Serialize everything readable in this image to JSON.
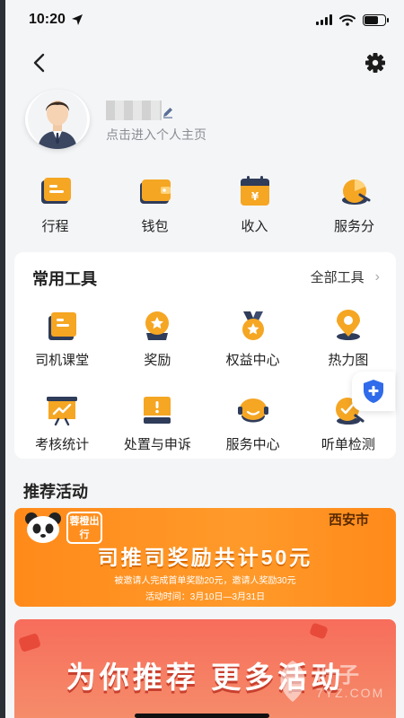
{
  "status_bar": {
    "time": "10:20",
    "battery_level": 0.7
  },
  "profile": {
    "subtitle": "点击进入个人主页"
  },
  "quick_actions": [
    {
      "label": "行程",
      "icon": "itinerary-icon"
    },
    {
      "label": "钱包",
      "icon": "wallet-icon"
    },
    {
      "label": "收入",
      "icon": "income-icon"
    },
    {
      "label": "服务分",
      "icon": "service-score-icon"
    }
  ],
  "tools": {
    "title": "常用工具",
    "all_label": "全部工具",
    "items": [
      {
        "label": "司机课堂",
        "icon": "driver-class-icon"
      },
      {
        "label": "奖励",
        "icon": "reward-icon"
      },
      {
        "label": "权益中心",
        "icon": "benefits-icon"
      },
      {
        "label": "热力图",
        "icon": "heatmap-icon"
      },
      {
        "label": "考核统计",
        "icon": "assessment-icon"
      },
      {
        "label": "处置与申诉",
        "icon": "appeal-icon"
      },
      {
        "label": "服务中心",
        "icon": "service-center-icon"
      },
      {
        "label": "听单检测",
        "icon": "order-check-icon"
      }
    ]
  },
  "activities": {
    "section_title": "推荐活动",
    "banner1": {
      "brand": "蓉橙出行",
      "city": "西安市",
      "title": "司推司奖励共计50元",
      "description": "被邀请人完成首单奖励20元，邀请人奖励30元",
      "time": "活动时间：3月10日—3月31日"
    },
    "banner2": {
      "title": "为你推荐  更多活动"
    }
  },
  "watermark": {
    "name": "叶子",
    "site": "7YZ.COM"
  },
  "colors": {
    "accent": "#f5a623",
    "icon_dark": "#2f3c5a",
    "banner_orange": "#ff8a1a",
    "banner_red": "#f76d5b"
  }
}
